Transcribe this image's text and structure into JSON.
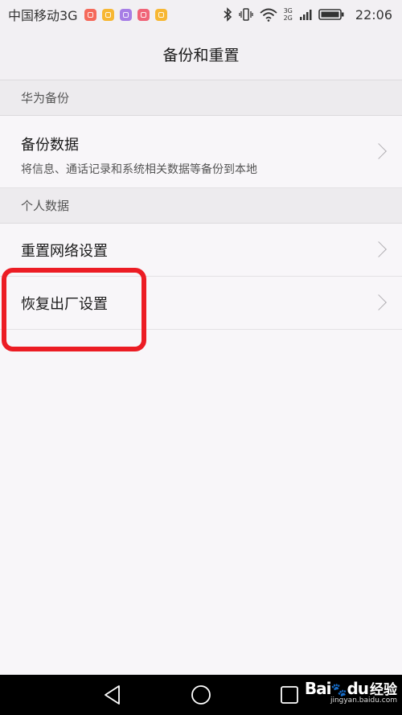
{
  "status_bar": {
    "carrier": "中国移动3G",
    "notification_icons": [
      {
        "name": "app-notification-icon",
        "color": "#f5695a"
      },
      {
        "name": "app-notification-icon",
        "color": "#f7b733"
      },
      {
        "name": "gallery-notification-icon",
        "color": "#a77ee6"
      },
      {
        "name": "huawei-notification-icon",
        "color": "#f06478"
      },
      {
        "name": "app-notification-icon",
        "color": "#f7b733"
      }
    ],
    "network_top": "3G",
    "network_bottom": "2G",
    "time": "22:06"
  },
  "title_bar": {
    "title": "备份和重置"
  },
  "sections": [
    {
      "header": "华为备份",
      "items": [
        {
          "title": "备份数据",
          "subtitle": "将信息、通话记录和系统相关数据等备份到本地"
        }
      ]
    },
    {
      "header": "个人数据",
      "items": [
        {
          "title": "重置网络设置"
        },
        {
          "title": "恢复出厂设置"
        }
      ]
    }
  ],
  "colors": {
    "highlight": "#ec1c24",
    "background": "#f8f6f9",
    "section_header_bg": "#edebee"
  },
  "watermark": {
    "brand": "Bai",
    "brand_suffix": "du",
    "product": "经验",
    "url": "jingyan.baidu.com"
  }
}
